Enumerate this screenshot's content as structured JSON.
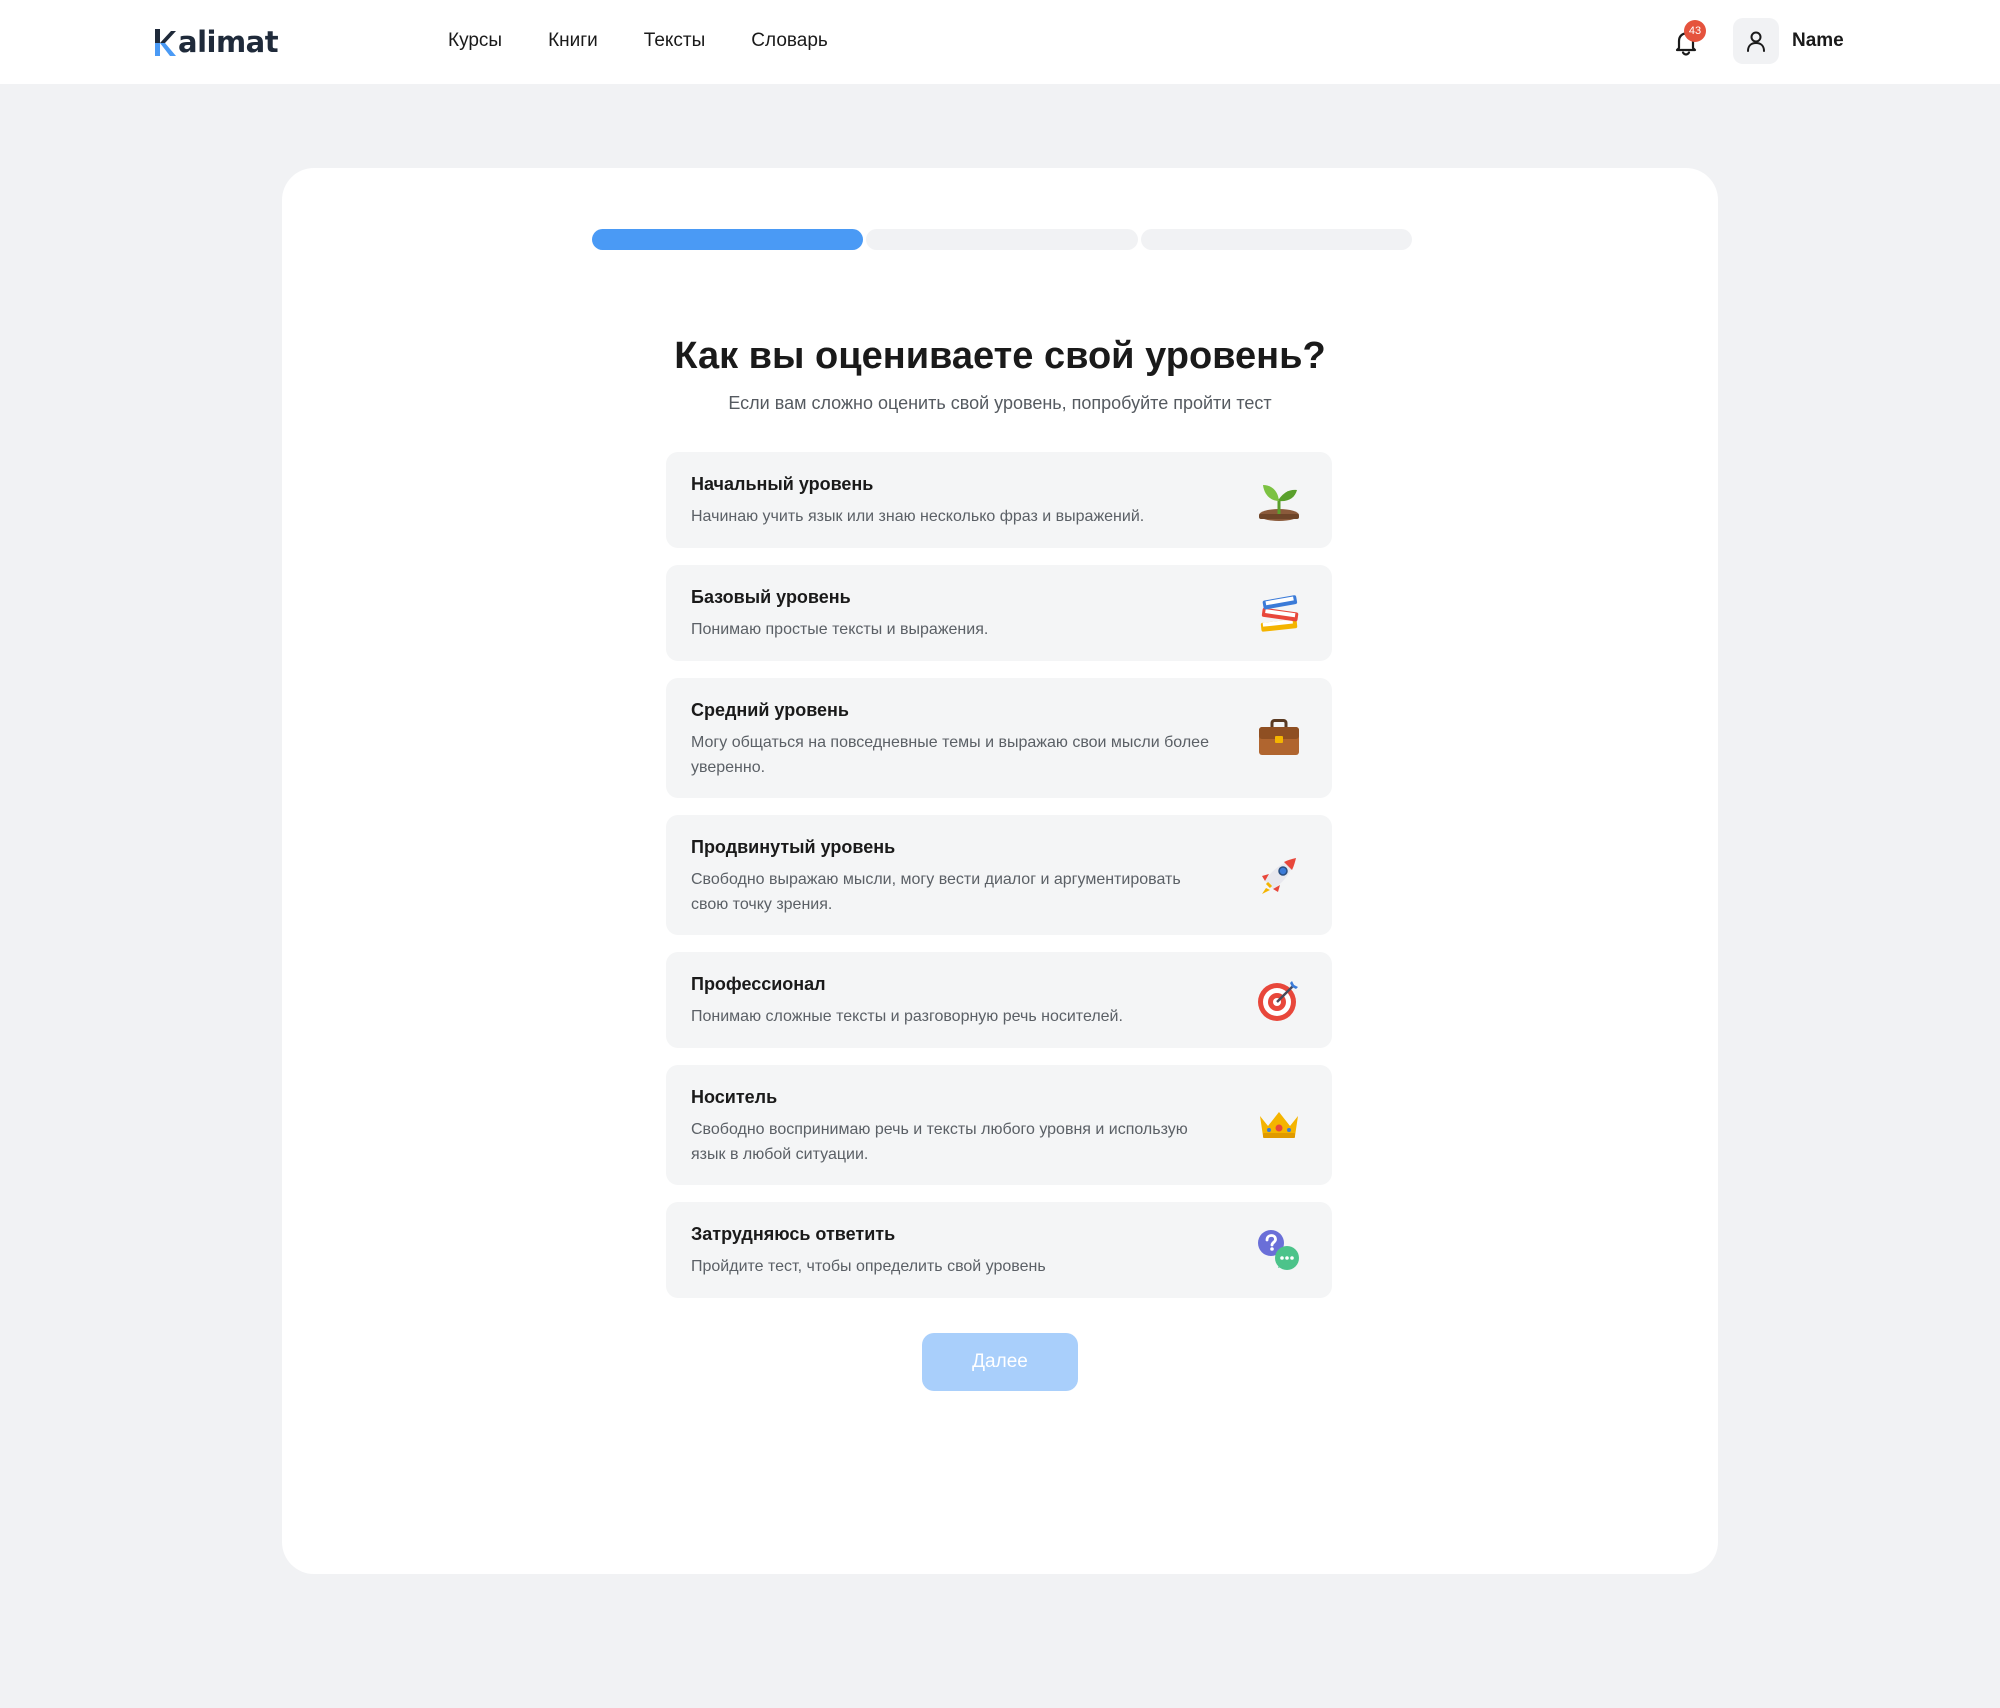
{
  "header": {
    "logo_text": "alimat",
    "nav": [
      "Курсы",
      "Книги",
      "Тексты",
      "Словарь"
    ],
    "notification_count": "43",
    "user_name": "Name"
  },
  "progress": {
    "total_steps": 3,
    "current_step": 1
  },
  "page": {
    "title": "Как вы оцениваете свой уровень?",
    "subtitle": "Если вам сложно оценить свой уровень, попробуйте пройти тест"
  },
  "options": [
    {
      "title": "Начальный уровень",
      "description": "Начинаю учить язык или знаю несколько фраз и выражений.",
      "icon": "seedling-icon"
    },
    {
      "title": "Базовый уровень",
      "description": "Понимаю простые тексты и выражения.",
      "icon": "books-icon"
    },
    {
      "title": "Средний уровень",
      "description": "Могу общаться на повседневные темы и выражаю свои мысли более уверенно.",
      "icon": "briefcase-icon"
    },
    {
      "title": "Продвинутый уровень",
      "description": "Свободно выражаю мысли, могу вести диалог и аргументировать свою точку зрения.",
      "icon": "rocket-icon"
    },
    {
      "title": "Профессионал",
      "description": "Понимаю сложные тексты и разговорную речь носителей.",
      "icon": "target-icon"
    },
    {
      "title": "Носитель",
      "description": "Свободно воспринимаю речь и тексты любого уровня и использую язык в любой ситуации.",
      "icon": "crown-icon"
    },
    {
      "title": "Затрудняюсь ответить",
      "description": "Пройдите тест, чтобы определить свой уровень",
      "icon": "question-chat-icon"
    }
  ],
  "next_button": {
    "label": "Далее",
    "disabled": true
  },
  "colors": {
    "accent": "#4a9af5",
    "button_disabled": "#a9cffb",
    "badge": "#e5533d",
    "background": "#f1f2f4"
  }
}
